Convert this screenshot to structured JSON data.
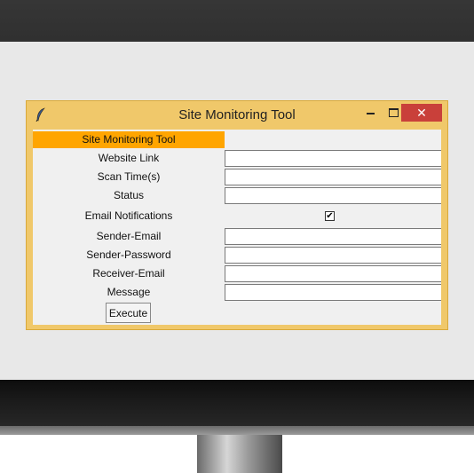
{
  "window": {
    "title": "Site Monitoring Tool",
    "close_glyph": "✕"
  },
  "form": {
    "heading": "Site Monitoring Tool",
    "fields": {
      "website_link": {
        "label": "Website Link",
        "value": ""
      },
      "scan_time": {
        "label": "Scan Time(s)",
        "value": ""
      },
      "status": {
        "label": "Status",
        "value": ""
      },
      "email_notifications": {
        "label": "Email Notifications",
        "checked": true,
        "check_glyph": "✔"
      },
      "sender_email": {
        "label": "Sender-Email",
        "value": ""
      },
      "sender_password": {
        "label": "Sender-Password",
        "value": ""
      },
      "receiver_email": {
        "label": "Receiver-Email",
        "value": ""
      },
      "message": {
        "label": "Message",
        "value": ""
      }
    },
    "execute_label": "Execute"
  },
  "colors": {
    "title_bar": "#f0c86a",
    "heading_highlight": "#ffa500",
    "close_button": "#c9403a"
  },
  "icons": {
    "app": "feather-icon",
    "minimize": "minimize-icon",
    "maximize": "maximize-icon",
    "close": "close-icon"
  }
}
